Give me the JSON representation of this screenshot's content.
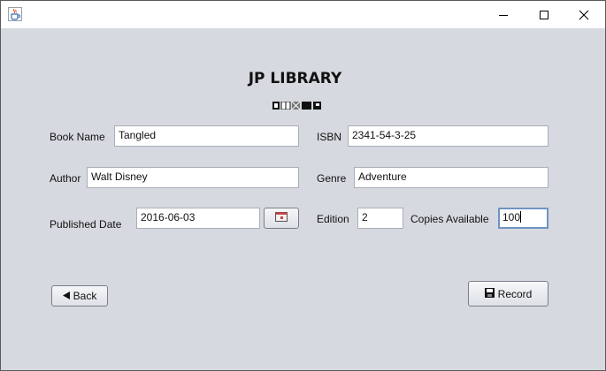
{
  "window": {
    "title": "",
    "icons": {
      "app": "java-cup-icon",
      "minimize": "minimize-icon",
      "maximize": "maximize-icon",
      "close": "close-icon"
    }
  },
  "header": {
    "title": "JP LIBRARY",
    "logo_icon": "library-logo-icon"
  },
  "form": {
    "book_name": {
      "label": "Book Name",
      "value": "Tangled"
    },
    "isbn": {
      "label": "ISBN",
      "value": "2341-54-3-25"
    },
    "author": {
      "label": "Author",
      "value": "Walt Disney"
    },
    "genre": {
      "label": "Genre",
      "value": "Adventure"
    },
    "published_date": {
      "label": "Published Date",
      "value": "2016-06-03",
      "picker_icon": "calendar-icon"
    },
    "edition": {
      "label": "Edition",
      "value": "2"
    },
    "copies_available": {
      "label": "Copies Available",
      "value": "100"
    }
  },
  "buttons": {
    "back": {
      "label": "Back",
      "icon": "left-arrow-icon"
    },
    "record": {
      "label": "Record",
      "icon": "floppy-disk-icon"
    }
  }
}
